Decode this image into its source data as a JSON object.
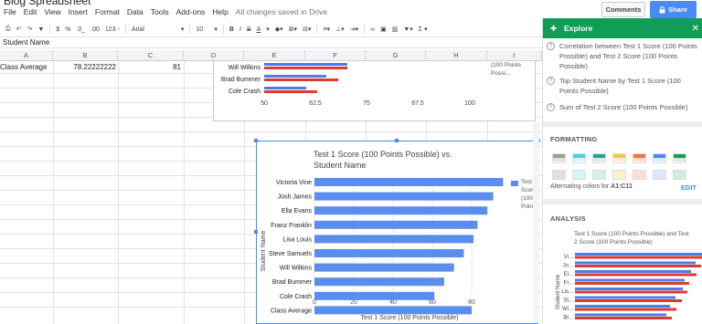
{
  "title": "Blog Spreadsheet",
  "menu": [
    "File",
    "Edit",
    "View",
    "Insert",
    "Format",
    "Data",
    "Tools",
    "Add-ons",
    "Help"
  ],
  "save_status": "All changes saved in Drive",
  "comments_label": "Comments",
  "share_label": "Share",
  "toolbar": {
    "currency": "$",
    "percent": "%",
    "dec_dec": ".0_",
    "dec_inc": ".00",
    "format": "123 -",
    "font": "Arial",
    "font_size": "10",
    "bold": "B",
    "italic": "I",
    "strike": "S",
    "color": "A"
  },
  "formula_bar": "Student Name",
  "columns": [
    "A",
    "B",
    "C",
    "D",
    "E",
    "F",
    "G",
    "H",
    "I"
  ],
  "row1": {
    "a": "Class Average",
    "b": "78.22222222",
    "c": "81"
  },
  "top_chart": {
    "names": [
      "Will Wilkins",
      "Brad Bummer",
      "Cole Crash"
    ],
    "ticks": [
      "50",
      "62.5",
      "75",
      "87.5",
      "100"
    ],
    "legend": "(100 Points Possi..."
  },
  "chart_data": {
    "type": "bar",
    "title": "Test 1 Score (100 Points Possible) vs. Student Name",
    "xlabel": "Test 1 Score (100 Points Possible)",
    "ylabel": "Student Name",
    "categories": [
      "Victoria Vine",
      "Josh James",
      "Ella Evans",
      "Franz Franklin",
      "Lisa Louis",
      "Steve Samuels",
      "Will Wilkins",
      "Brad Bummer",
      "Cole Crash",
      "Class Average"
    ],
    "values": [
      96,
      91,
      88,
      83,
      81,
      76,
      71,
      66,
      61,
      80
    ],
    "xlim": [
      0,
      100
    ],
    "xticks": [
      "0",
      "20",
      "40",
      "60",
      "80"
    ],
    "legend": "Test 1 Score (100 Points Possible)",
    "legend_position": "right",
    "color": "#5b8def"
  },
  "explore": {
    "title": "Explore",
    "questions": [
      "Correlation between Test 1 Score (100 Points Possible) and Test 2 Score (100 Points Possible)",
      "Top Student Name by Test 1 Score (100 Points Possible)",
      "Sum of Test 2 Score (100 Points Possible)"
    ],
    "formatting_title": "FORMATTING",
    "alt_label": "Alternating colors for",
    "alt_range": "A1:C11",
    "edit_label": "EDIT",
    "analysis_title": "ANALYSIS",
    "analysis_chart_title": "Test 1 Score (100 Points Possible) and Test 2 Score (100 Points Possible)",
    "analysis_ylabel": "Student Name",
    "analysis_labels": [
      "Vi...",
      "Jo...",
      "El...",
      "Fr...",
      "Lis...",
      "St...",
      "Wi...",
      "Br..."
    ],
    "swatches": [
      [
        "#9e9e9e",
        "#e0e0e0"
      ],
      [
        "#4dd0e1",
        "#d6f5f8"
      ],
      [
        "#26a69a",
        "#d7efec"
      ],
      [
        "#f6c544",
        "#fdf1cf"
      ],
      [
        "#f4733b",
        "#fde0d3"
      ],
      [
        "#4a8af4",
        "#dbe7fc"
      ],
      [
        "#0f9d58",
        "#d3ece0"
      ]
    ]
  }
}
